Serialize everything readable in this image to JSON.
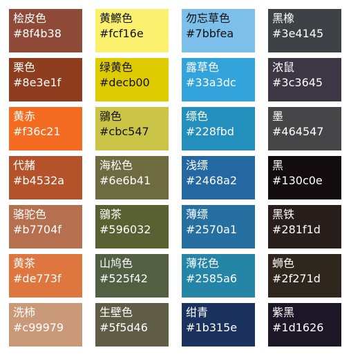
{
  "swatches": [
    {
      "name": "桧皮色",
      "hex": "#8f4b38",
      "color": "#8f4b38",
      "text": "light"
    },
    {
      "name": "黄鰶色",
      "hex": "#fcf16e",
      "color": "#fcf16e",
      "text": "dark"
    },
    {
      "name": "勿忘草色",
      "hex": "#7bbfea",
      "color": "#7bbfea",
      "text": "dark"
    },
    {
      "name": "黑橡",
      "hex": "#3e4145",
      "color": "#3e4145",
      "text": "light"
    },
    {
      "name": "栗色",
      "hex": "#8e3e1f",
      "color": "#8e3e1f",
      "text": "light"
    },
    {
      "name": "绿黄色",
      "hex": "#decb00",
      "color": "#decb00",
      "text": "dark"
    },
    {
      "name": "露草色",
      "hex": "#33a3dc",
      "color": "#33a3dc",
      "text": "light"
    },
    {
      "name": "浓鼠",
      "hex": "#3c3645",
      "color": "#3c3645",
      "text": "light"
    },
    {
      "name": "黄赤",
      "hex": "#f36c21",
      "color": "#f36c21",
      "text": "light"
    },
    {
      "name": "鶸色",
      "hex": "#cbc547",
      "color": "#cbc547",
      "text": "dark"
    },
    {
      "name": "缥色",
      "hex": "#228fbd",
      "color": "#228fbd",
      "text": "light"
    },
    {
      "name": "墨",
      "hex": "#464547",
      "color": "#464547",
      "text": "light"
    },
    {
      "name": "代赭",
      "hex": "#b4532a",
      "color": "#b4532a",
      "text": "light"
    },
    {
      "name": "海松色",
      "hex": "#6e6b41",
      "color": "#6e6b41",
      "text": "light"
    },
    {
      "name": "浅缥",
      "hex": "#2468a2",
      "color": "#2468a2",
      "text": "light"
    },
    {
      "name": "黑",
      "hex": "#130c0e",
      "color": "#130c0e",
      "text": "light"
    },
    {
      "name": "骆驼色",
      "hex": "#b7704f",
      "color": "#b7704f",
      "text": "light"
    },
    {
      "name": "鶸茶",
      "hex": "#596032",
      "color": "#596032",
      "text": "light"
    },
    {
      "name": "薄缥",
      "hex": "#2570a1",
      "color": "#2570a1",
      "text": "light"
    },
    {
      "name": "黑铁",
      "hex": "#281f1d",
      "color": "#281f1d",
      "text": "light"
    },
    {
      "name": "黄茶",
      "hex": "#de773f",
      "color": "#de773f",
      "text": "light"
    },
    {
      "name": "山鸠色",
      "hex": "#525f42",
      "color": "#525f42",
      "text": "light"
    },
    {
      "name": "薄花色",
      "hex": "#2585a6",
      "color": "#2585a6",
      "text": "light"
    },
    {
      "name": "蛳色",
      "hex": "#2f271d",
      "color": "#2f271d",
      "text": "light"
    },
    {
      "name": "洗柿",
      "hex": "#c99979",
      "color": "#c99979",
      "text": "light"
    },
    {
      "name": "生壁色",
      "hex": "#5f5d46",
      "color": "#5f5d46",
      "text": "light"
    },
    {
      "name": "绀青",
      "hex": "#1b315e",
      "color": "#1b315e",
      "text": "light"
    },
    {
      "name": "紫黑",
      "hex": "#1d1626",
      "color": "#1d1626",
      "text": "light"
    }
  ]
}
